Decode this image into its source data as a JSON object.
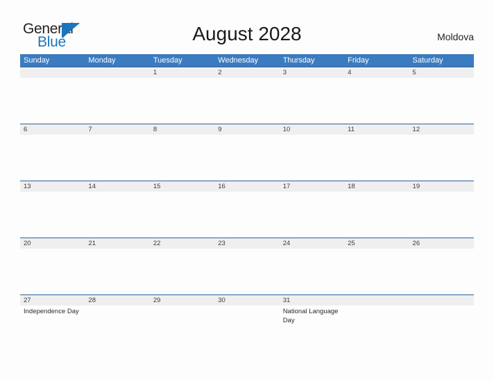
{
  "logo": {
    "word_one": "General",
    "word_two": "Blue",
    "flag_icon": "blue-triangle-flag-icon",
    "color_dark": "#231f20",
    "color_blue": "#1b75bc"
  },
  "header": {
    "title": "August 2028",
    "region": "Moldova"
  },
  "theme": {
    "header_blue": "#3b7cc0",
    "divider_blue": "#2a6099",
    "date_band": "#efefef",
    "page_background": "#fdfdfd"
  },
  "calendar": {
    "day_names": [
      "Sunday",
      "Monday",
      "Tuesday",
      "Wednesday",
      "Thursday",
      "Friday",
      "Saturday"
    ],
    "weeks": [
      {
        "days": [
          {
            "date": "",
            "event": ""
          },
          {
            "date": "",
            "event": ""
          },
          {
            "date": "1",
            "event": ""
          },
          {
            "date": "2",
            "event": ""
          },
          {
            "date": "3",
            "event": ""
          },
          {
            "date": "4",
            "event": ""
          },
          {
            "date": "5",
            "event": ""
          }
        ]
      },
      {
        "days": [
          {
            "date": "6",
            "event": ""
          },
          {
            "date": "7",
            "event": ""
          },
          {
            "date": "8",
            "event": ""
          },
          {
            "date": "9",
            "event": ""
          },
          {
            "date": "10",
            "event": ""
          },
          {
            "date": "11",
            "event": ""
          },
          {
            "date": "12",
            "event": ""
          }
        ]
      },
      {
        "days": [
          {
            "date": "13",
            "event": ""
          },
          {
            "date": "14",
            "event": ""
          },
          {
            "date": "15",
            "event": ""
          },
          {
            "date": "16",
            "event": ""
          },
          {
            "date": "17",
            "event": ""
          },
          {
            "date": "18",
            "event": ""
          },
          {
            "date": "19",
            "event": ""
          }
        ]
      },
      {
        "days": [
          {
            "date": "20",
            "event": ""
          },
          {
            "date": "21",
            "event": ""
          },
          {
            "date": "22",
            "event": ""
          },
          {
            "date": "23",
            "event": ""
          },
          {
            "date": "24",
            "event": ""
          },
          {
            "date": "25",
            "event": ""
          },
          {
            "date": "26",
            "event": ""
          }
        ]
      },
      {
        "days": [
          {
            "date": "27",
            "event": "Independence Day"
          },
          {
            "date": "28",
            "event": ""
          },
          {
            "date": "29",
            "event": ""
          },
          {
            "date": "30",
            "event": ""
          },
          {
            "date": "31",
            "event": "National Language Day"
          },
          {
            "date": "",
            "event": ""
          },
          {
            "date": "",
            "event": ""
          }
        ]
      }
    ]
  }
}
